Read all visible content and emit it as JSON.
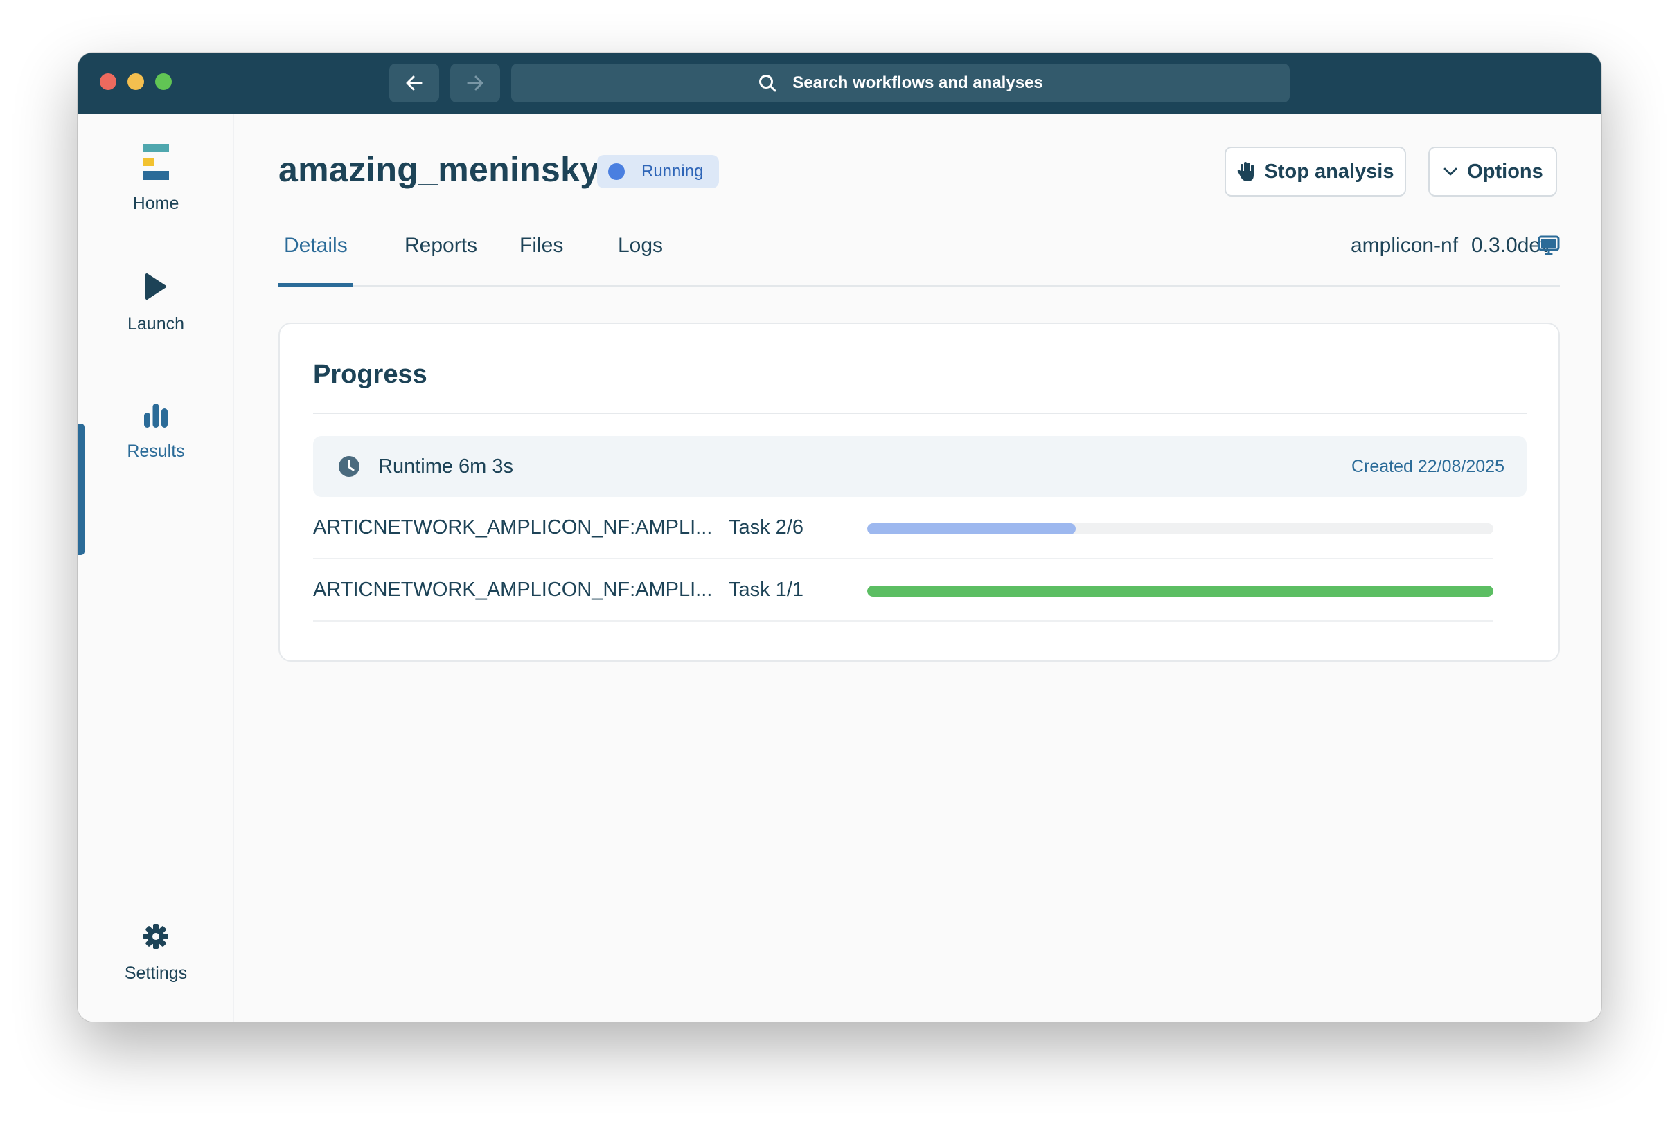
{
  "window": {
    "traffic_lights": {
      "close": "#ed6a5e",
      "minimize": "#f4bf4f",
      "zoom": "#61c554"
    }
  },
  "toolbar": {
    "search_placeholder": "Search workflows and analyses"
  },
  "sidebar": {
    "items": [
      {
        "label": "Home",
        "icon": "app-logo-icon"
      },
      {
        "label": "Launch",
        "icon": "play-icon"
      },
      {
        "label": "Results",
        "icon": "bar-chart-icon",
        "active": true
      },
      {
        "label": "Settings",
        "icon": "gear-icon"
      }
    ]
  },
  "header": {
    "title": "amazing_meninsky",
    "status": "Running",
    "stop_label": "Stop analysis",
    "options_label": "Options"
  },
  "tabs": [
    {
      "label": "Details",
      "active": true
    },
    {
      "label": "Reports"
    },
    {
      "label": "Files"
    },
    {
      "label": "Logs"
    }
  ],
  "workflow": {
    "name": "amplicon-nf",
    "version": "0.3.0dev"
  },
  "progress": {
    "title": "Progress",
    "runtime": "Runtime 6m 3s",
    "created": "Created 22/08/2025",
    "tasks": [
      {
        "name": "ARTICNETWORK_AMPLICON_NF:AMPLI...",
        "count": "Task 2/6",
        "fraction": 0.3333,
        "color": "#9db8ef"
      },
      {
        "name": "ARTICNETWORK_AMPLICON_NF:AMPLI...",
        "count": "Task 1/1",
        "fraction": 1.0,
        "color": "#5cbe63"
      }
    ]
  },
  "colors": {
    "titlebar": "#1c4458",
    "accent": "#2b6b98",
    "text": "#1d4357"
  }
}
